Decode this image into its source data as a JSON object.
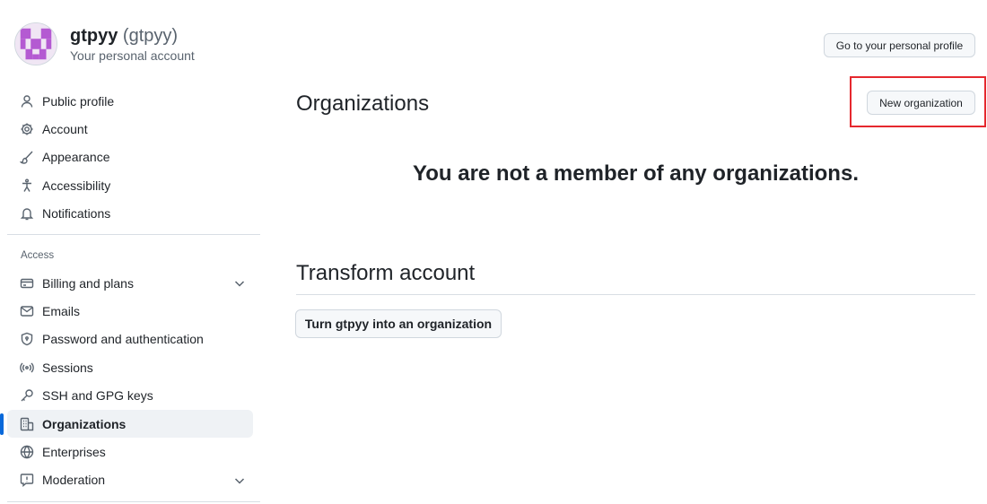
{
  "identity": {
    "name": "gtpyy",
    "login": "(gtpyy)",
    "subtitle": "Your personal account"
  },
  "header": {
    "profile_button": "Go to your personal profile"
  },
  "sidebar": {
    "items": [
      {
        "label": "Public profile",
        "icon": "person-icon"
      },
      {
        "label": "Account",
        "icon": "gear-icon"
      },
      {
        "label": "Appearance",
        "icon": "paintbrush-icon"
      },
      {
        "label": "Accessibility",
        "icon": "accessibility-icon"
      },
      {
        "label": "Notifications",
        "icon": "bell-icon"
      }
    ],
    "access_label": "Access",
    "access_items": [
      {
        "label": "Billing and plans",
        "icon": "credit-card-icon",
        "expandable": true
      },
      {
        "label": "Emails",
        "icon": "mail-icon"
      },
      {
        "label": "Password and authentication",
        "icon": "shield-lock-icon"
      },
      {
        "label": "Sessions",
        "icon": "broadcast-icon"
      },
      {
        "label": "SSH and GPG keys",
        "icon": "key-icon"
      },
      {
        "label": "Organizations",
        "icon": "organization-icon",
        "active": true
      },
      {
        "label": "Enterprises",
        "icon": "globe-icon"
      },
      {
        "label": "Moderation",
        "icon": "report-icon",
        "expandable": true
      }
    ]
  },
  "main": {
    "organizations_title": "Organizations",
    "new_org_button": "New organization",
    "empty_message": "You are not a member of any organizations.",
    "transform_title": "Transform account",
    "transform_button": "Turn gtpyy into an organization"
  },
  "colors": {
    "accent": "#0969da",
    "highlight": "#e5282e",
    "avatar": "#b45ad2"
  }
}
